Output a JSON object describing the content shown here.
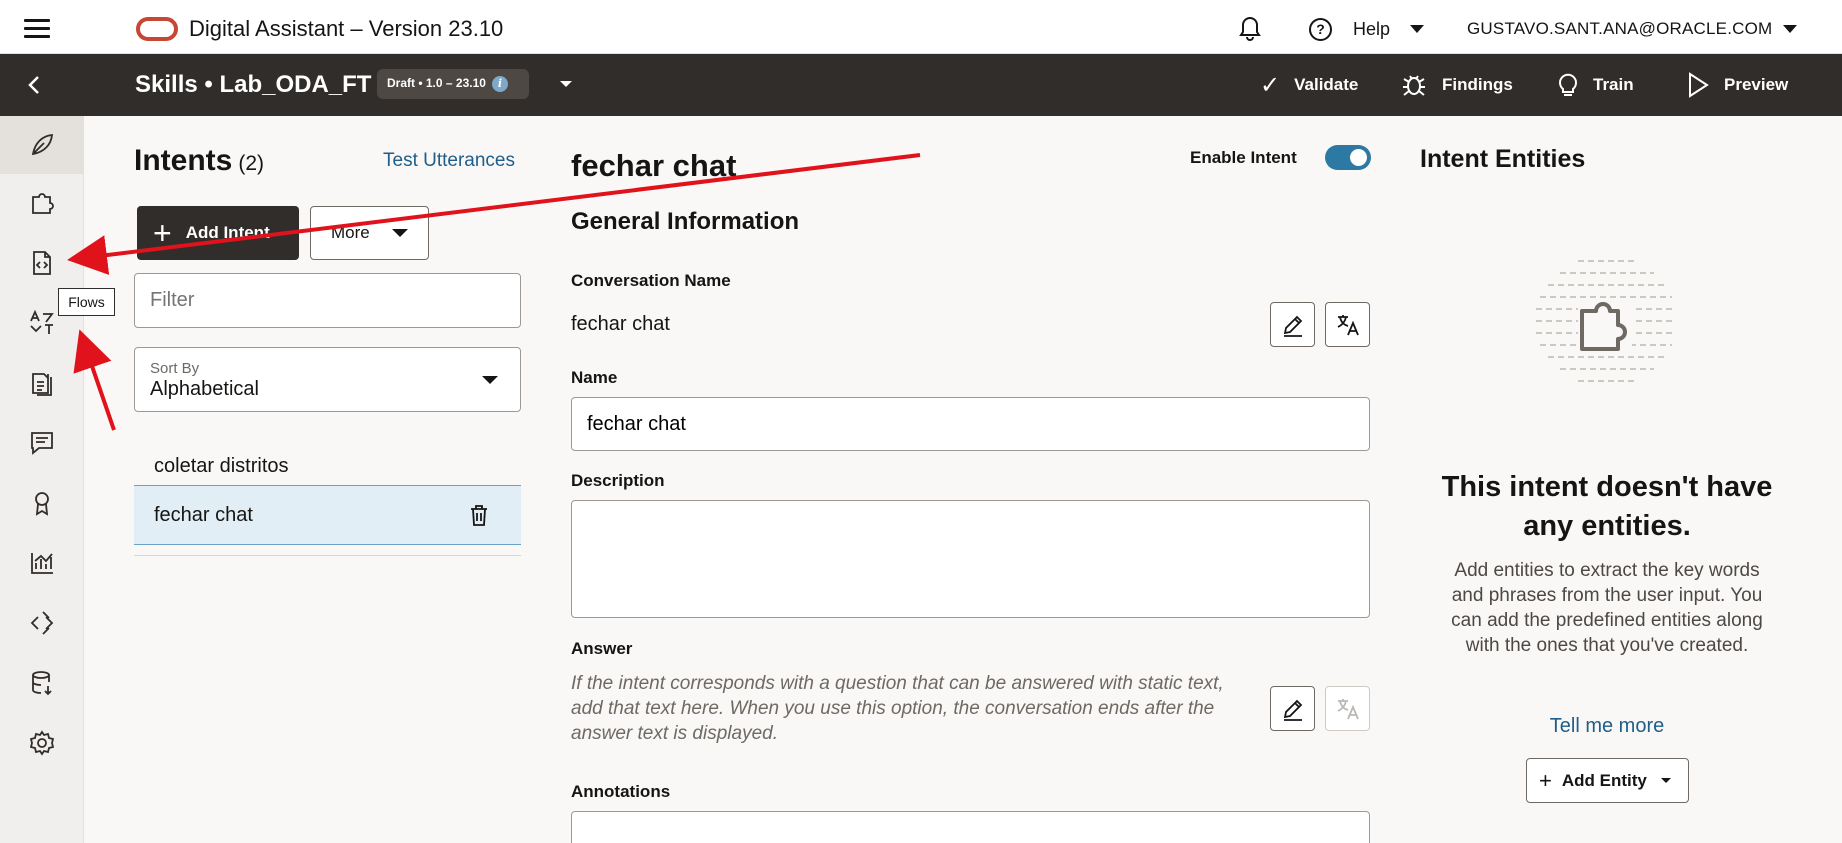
{
  "topbar": {
    "title": "Digital Assistant – Version 23.10",
    "help_label": "Help",
    "user_email": "GUSTAVO.SANT.ANA@ORACLE.COM",
    "brand_color": "#c74634"
  },
  "skillbar": {
    "title": "Skills • Lab_ODA_FT",
    "badge": "Draft • 1.0 – 23.10",
    "actions": {
      "validate": "Validate",
      "findings": "Findings",
      "train": "Train",
      "preview": "Preview"
    }
  },
  "rail": {
    "items": [
      "leaf-icon",
      "puzzle-icon",
      "flows-icon",
      "translate-icon",
      "documents-icon",
      "chat-icon",
      "badge-icon",
      "analytics-icon",
      "code-icon",
      "database-icon",
      "gear-icon"
    ],
    "tooltip": "Flows"
  },
  "intents": {
    "title": "Intents",
    "count": "(2)",
    "test_utterances": "Test Utterances",
    "add_intent": "Add Intent",
    "more": "More",
    "filter_placeholder": "Filter",
    "sort_label": "Sort By",
    "sort_value": "Alphabetical",
    "items": [
      {
        "label": "coletar distritos",
        "selected": false
      },
      {
        "label": "fechar chat",
        "selected": true
      }
    ]
  },
  "form": {
    "intent_name": "fechar chat",
    "enable_label": "Enable Intent",
    "enabled": true,
    "section_title": "General Information",
    "conversation_name_label": "Conversation Name",
    "conversation_name_value": "fechar chat",
    "name_label": "Name",
    "name_value": "fechar chat",
    "description_label": "Description",
    "description_value": "",
    "answer_label": "Answer",
    "answer_placeholder": "If the intent corresponds with a question that can be answered with static text, add that text here. When you use this option, the conversation ends after the answer text is displayed.",
    "annotations_label": "Annotations"
  },
  "entities": {
    "title": "Intent Entities",
    "empty_title": "This intent doesn't have any entities.",
    "empty_desc": "Add entities to extract the key words and phrases from the user input. You can add the predefined entities along with the ones that you've created.",
    "tell_more": "Tell me more",
    "add_entity": "Add Entity"
  },
  "colors": {
    "header_dark": "#312d2a",
    "accent_teal": "#2c7aa3",
    "link_blue": "#1f5e8a",
    "selected_bg": "#e1eef6",
    "annotation_red": "#e0121b"
  }
}
